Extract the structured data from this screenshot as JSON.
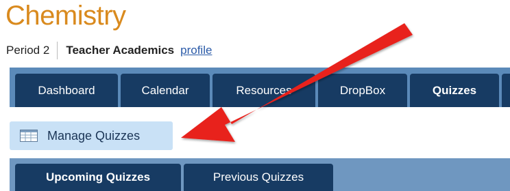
{
  "header": {
    "course_title": "Chemistry",
    "period": "Period 2",
    "teacher": "Teacher Academics",
    "profile_link": "profile"
  },
  "nav": {
    "tabs": [
      {
        "label": "Dashboard"
      },
      {
        "label": "Calendar"
      },
      {
        "label": "Resources"
      },
      {
        "label": "DropBox"
      },
      {
        "label": "Quizzes"
      }
    ],
    "active_tab": "Quizzes"
  },
  "toolbar": {
    "manage_label": "Manage Quizzes",
    "manage_icon": "table-icon"
  },
  "subnav": {
    "tabs": [
      {
        "label": "Upcoming Quizzes"
      },
      {
        "label": "Previous Quizzes"
      }
    ],
    "active_tab": "Upcoming Quizzes"
  },
  "annotation": {
    "arrow_color": "#e8201c"
  },
  "colors": {
    "title": "#d98a1e",
    "tab_dark": "#173b63",
    "tab_band": "#5b8ab9",
    "button_bg": "#c9e1f6",
    "link": "#2a5aa8"
  }
}
